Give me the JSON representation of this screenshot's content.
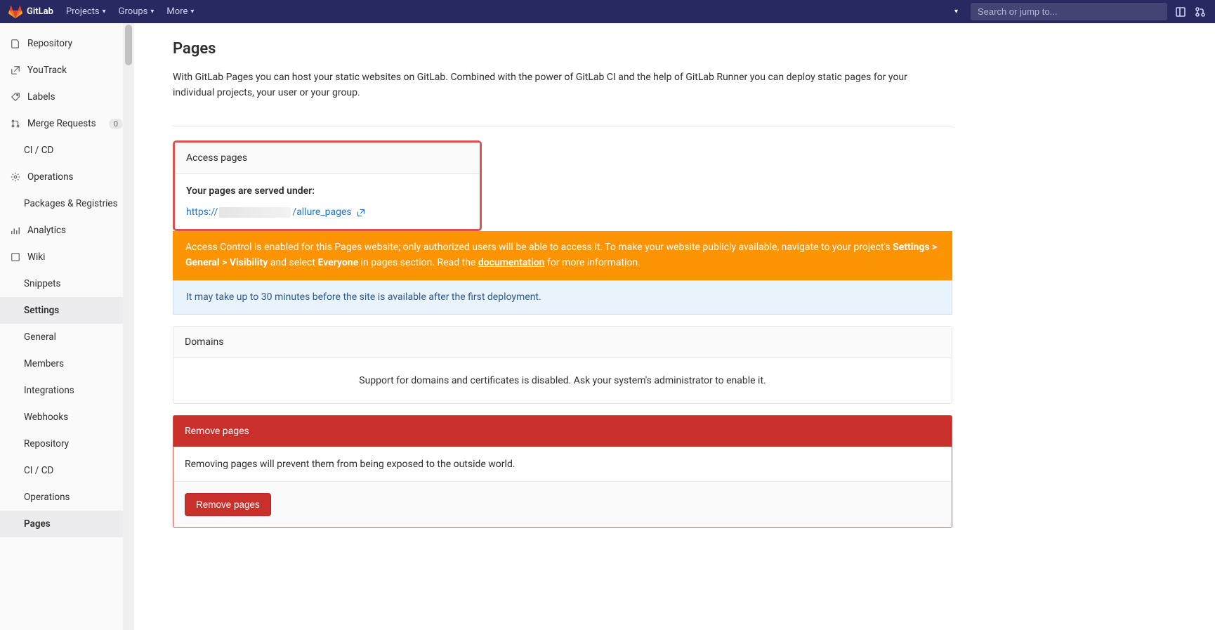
{
  "topbar": {
    "brand": "GitLab",
    "nav": {
      "projects": "Projects",
      "groups": "Groups",
      "more": "More"
    },
    "search_placeholder": "Search or jump to..."
  },
  "sidebar": {
    "items": [
      {
        "label": "Repository"
      },
      {
        "label": "YouTrack"
      },
      {
        "label": "Labels"
      },
      {
        "label": "Merge Requests",
        "badge": "0"
      },
      {
        "label": "CI / CD"
      },
      {
        "label": "Operations"
      },
      {
        "label": "Packages & Registries"
      },
      {
        "label": "Analytics"
      },
      {
        "label": "Wiki"
      },
      {
        "label": "Snippets"
      },
      {
        "label": "Settings"
      },
      {
        "label": "General"
      },
      {
        "label": "Members"
      },
      {
        "label": "Integrations"
      },
      {
        "label": "Webhooks"
      },
      {
        "label": "Repository"
      },
      {
        "label": "CI / CD"
      },
      {
        "label": "Operations"
      },
      {
        "label": "Pages"
      }
    ]
  },
  "page": {
    "title": "Pages",
    "description": "With GitLab Pages you can host your static websites on GitLab. Combined with the power of GitLab CI and the help of GitLab Runner you can deploy static pages for your individual projects, your user or your group."
  },
  "access": {
    "header": "Access pages",
    "served_label": "Your pages are served under:",
    "url_prefix": "https://",
    "url_suffix": "/allure_pages"
  },
  "alerts": {
    "ac_1": "Access Control is enabled for this Pages website; only authorized users will be able to access it. To make your website publicly available, navigate to your project's ",
    "ac_settings": "Settings > General > Visibility",
    "ac_2": " and select ",
    "ac_everyone": "Everyone",
    "ac_3": " in pages section. Read the ",
    "ac_doc": "documentation",
    "ac_4": " for more information.",
    "info": "It may take up to 30 minutes before the site is available after the first deployment."
  },
  "domains": {
    "header": "Domains",
    "disabled_msg": "Support for domains and certificates is disabled. Ask your system's administrator to enable it."
  },
  "remove": {
    "header": "Remove pages",
    "body": "Removing pages will prevent them from being exposed to the outside world.",
    "button": "Remove pages"
  }
}
